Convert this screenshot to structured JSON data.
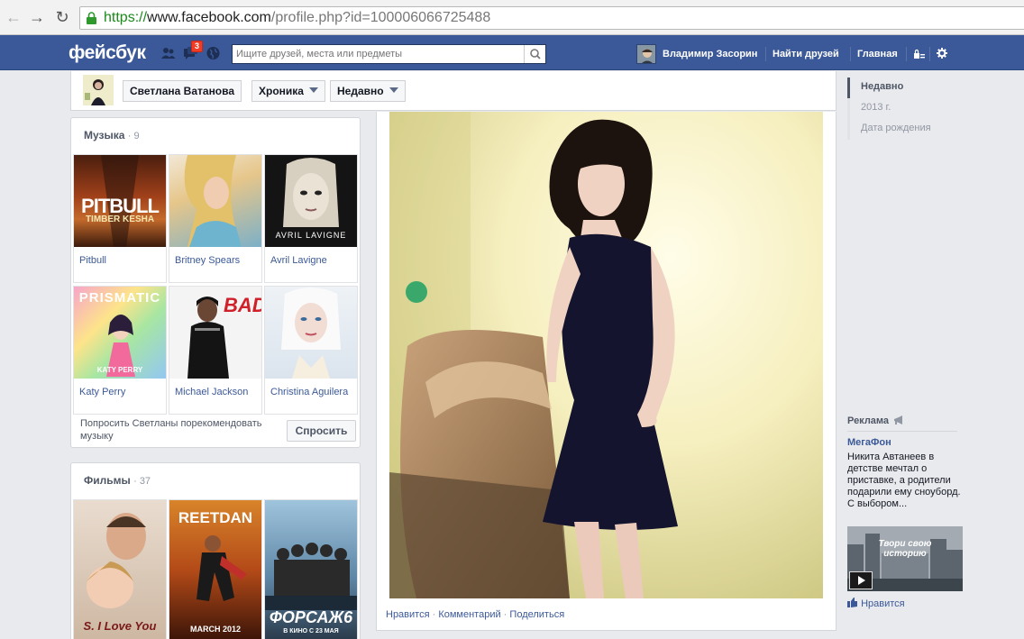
{
  "browser": {
    "url_scheme": "https://",
    "url_host": "www.facebook.com",
    "url_path": "/profile.php?id=100006066725488"
  },
  "topbar": {
    "logo": "фейсбук",
    "notification_count": "3",
    "search_placeholder": "Ищите друзей, места или предметы",
    "user_name": "Владимир Засорин",
    "find_friends": "Найти друзей",
    "home": "Главная"
  },
  "timeline_nav": {
    "name": "Светлана Ватанова",
    "section": "Хроника",
    "period": "Недавно"
  },
  "music": {
    "title": "Музыка",
    "count": "· 9",
    "items": [
      {
        "label": "Pitbull",
        "art_text": "PITBULL",
        "art_sub": "TIMBER KESHA"
      },
      {
        "label": "Britney Spears"
      },
      {
        "label": "Avril Lavigne",
        "art_text": "AVRIL LAVIGNE"
      },
      {
        "label": "Katy Perry",
        "art_text": "PRISMATIC",
        "art_sub": "KATY PERRY"
      },
      {
        "label": "Michael Jackson",
        "art_text": "BAD"
      },
      {
        "label": "Christina Aguilera"
      }
    ],
    "ask_text": "Попросить Светланы порекомендовать музыку",
    "ask_button": "Спросить"
  },
  "movies": {
    "title": "Фильмы",
    "count": "· 37",
    "items": [
      {
        "art_text": "S. I Love You"
      },
      {
        "art_text": "REETDAN",
        "art_sub": "MARCH 2012"
      },
      {
        "art_text": "ФОРСАЖ6",
        "art_sub": "В КИНО С 23 МАЯ"
      }
    ]
  },
  "post": {
    "like": "Нравится",
    "comment": "Комментарий",
    "share": "Поделиться",
    "sep": " · "
  },
  "scrubber": {
    "items": [
      "Недавно",
      "2013 г.",
      "Дата рождения"
    ]
  },
  "ads": {
    "title": "Реклама",
    "ad_name": "МегаФон",
    "ad_text": "Никита Автанеев в детстве мечтал о приставке, а родители подарили ему сноуборд. С выбором...",
    "ad_image_text": "Твори свою историю",
    "ad_like": "Нравится"
  },
  "colors": {
    "fb_blue": "#3b5998",
    "link": "#3b5998",
    "badge": "#f03d25"
  }
}
